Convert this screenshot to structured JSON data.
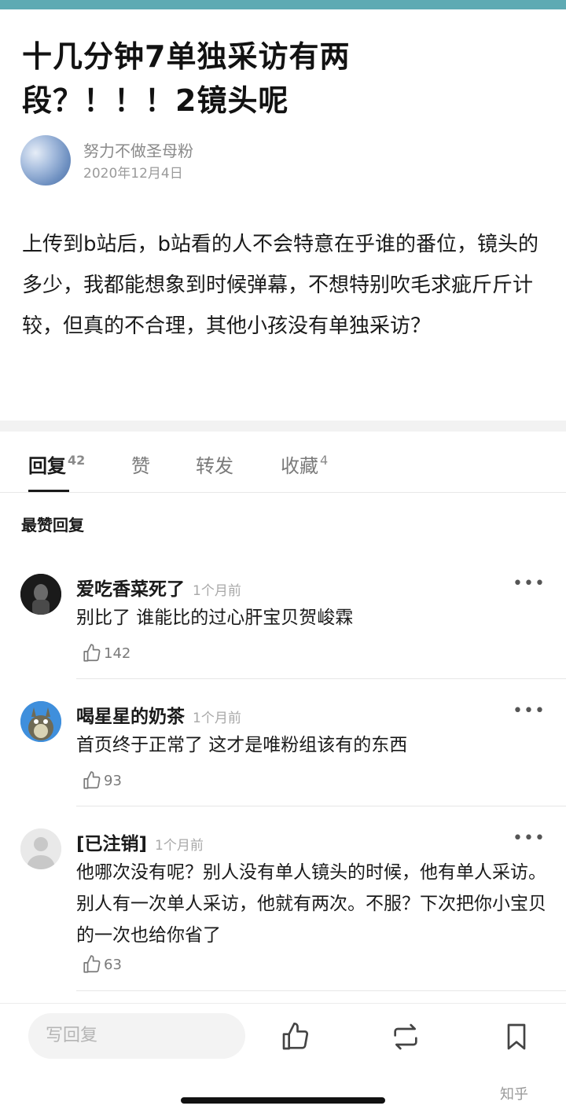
{
  "post": {
    "title_line1": "十几分钟7单独采访有两",
    "title_line2": "段？！！！2镜头呢",
    "author_name": "努力不做圣母粉",
    "date": "2020年12月4日",
    "body": "上传到b站后，b站看的人不会特意在乎谁的番位，镜头的多少，我都能想象到时候弹幕，不想特别吹毛求疵斤斤计较，但真的不合理，其他小孩没有单独采访？"
  },
  "tabs": [
    {
      "label": "回复",
      "count": "42"
    },
    {
      "label": "赞",
      "count": ""
    },
    {
      "label": "转发",
      "count": ""
    },
    {
      "label": "收藏",
      "count": "4"
    }
  ],
  "section_label": "最赞回复",
  "comments": [
    {
      "name": "爱吃香菜死了",
      "time": "1个月前",
      "text": "别比了 谁能比的过心肝宝贝贺峻霖",
      "likes": "142"
    },
    {
      "name": "喝星星的奶茶",
      "time": "1个月前",
      "text": "首页终于正常了 这才是唯粉组该有的东西",
      "likes": "93"
    },
    {
      "name": "[已注销]",
      "time": "1个月前",
      "text": "他哪次没有呢？别人没有单人镜头的时候，他有单人采访。别人有一次单人采访，他就有两次。不服？下次把你小宝贝的一次也给你省了",
      "likes": "63"
    }
  ],
  "more_label": "•••",
  "bottom_bar": {
    "reply_placeholder": "写回复",
    "icons": [
      "like-icon",
      "repost-icon",
      "bookmark-icon"
    ]
  },
  "watermark": "知乎",
  "colors": {
    "top_strip": "#5eaab3",
    "text": "#1a1a1a",
    "muted": "#8a8a8a"
  }
}
